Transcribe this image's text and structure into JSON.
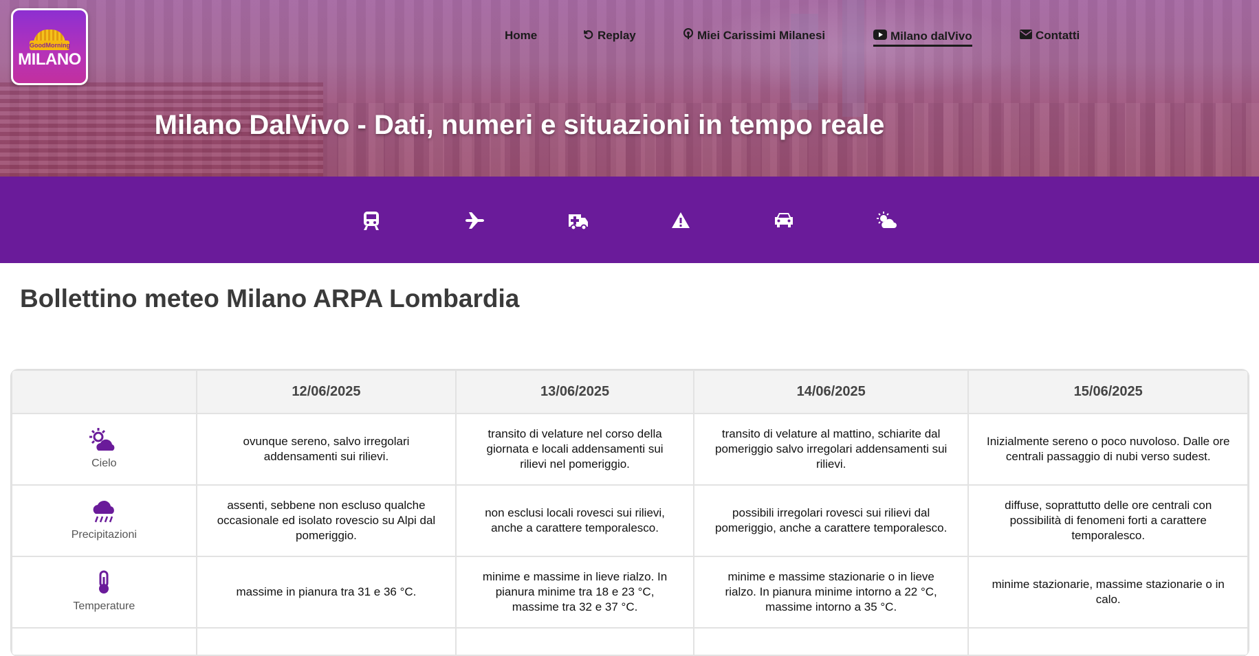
{
  "logo": {
    "badge": "GoodMorning",
    "word": "MILANO"
  },
  "nav": [
    {
      "label": "Home",
      "icon": ""
    },
    {
      "label": "Replay",
      "icon": "replay-icon"
    },
    {
      "label": "Miei Carissimi Milanesi",
      "icon": "podcast-icon"
    },
    {
      "label": "Milano dalVivo",
      "icon": "youtube-icon",
      "active": true
    },
    {
      "label": "Contatti",
      "icon": "envelope-icon"
    }
  ],
  "hero": {
    "title": "Milano DalVivo - Dati, numeri e situazioni in tempo reale"
  },
  "iconbar": {
    "color": "#6a1b9a",
    "items": [
      "train-icon",
      "plane-icon",
      "ambulance-icon",
      "warning-icon",
      "car-icon",
      "weather-icon"
    ]
  },
  "section": {
    "title": "Bollettino meteo Milano ARPA Lombardia"
  },
  "table": {
    "headers": [
      "",
      "12/06/2025",
      "13/06/2025",
      "14/06/2025",
      "15/06/2025"
    ],
    "rows": [
      {
        "label": "Cielo",
        "icon": "sun-cloud-icon",
        "cells": [
          "ovunque sereno, salvo irregolari addensamenti sui rilievi.",
          "transito di velature nel corso della giornata e locali addensamenti sui rilievi nel pomeriggio.",
          "transito di velature al mattino, schiarite dal pomeriggio salvo irregolari addensamenti sui rilievi.",
          "Inizialmente sereno o poco nuvoloso. Dalle ore centrali passaggio di nubi verso sudest."
        ]
      },
      {
        "label": "Precipitazioni",
        "icon": "rain-cloud-icon",
        "cells": [
          "assenti, sebbene non escluso qualche occasionale ed isolato rovescio su Alpi dal pomeriggio.",
          "non esclusi locali rovesci sui rilievi, anche a carattere temporalesco.",
          "possibili irregolari rovesci sui rilievi dal pomeriggio, anche a carattere temporalesco.",
          "diffuse, soprattutto delle ore centrali con possibilità di fenomeni forti a carattere temporalesco."
        ]
      },
      {
        "label": "Temperature",
        "icon": "thermometer-icon",
        "cells": [
          "massime in pianura tra 31 e 36 °C.",
          "minime e massime in lieve rialzo. In pianura minime tra 18 e 23 °C, massime tra 32 e 37 °C.",
          "minime e massime stazionarie o in lieve rialzo. In pianura minime intorno a 22 °C, massime intorno a 35 °C.",
          "minime stazionarie, massime stazionarie o in calo."
        ]
      }
    ]
  }
}
